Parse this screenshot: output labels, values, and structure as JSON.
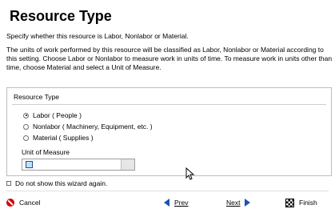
{
  "header": {
    "title": "Resource Type",
    "subtitle": "Specify whether this resource is Labor, Nonlabor or Material.",
    "description": "The units of work performed by this resource will be classified as Labor, Nonlabor or Material according to this setting. Choose Labor or Nonlabor to measure work in units of time.  To measure work in units other than time, choose Material and select a Unit of Measure."
  },
  "resource_type": {
    "group_label": "Resource Type",
    "options": [
      {
        "label": "Labor ( People )",
        "selected": true
      },
      {
        "label": "Nonlabor ( Machinery, Equipment, etc. )",
        "selected": false
      },
      {
        "label": "Material ( Supplies )",
        "selected": false
      }
    ],
    "unit_label": "Unit of Measure",
    "unit_value": ""
  },
  "wizard": {
    "do_not_show_label": "Do not show this wizard again.",
    "checked": false
  },
  "footer": {
    "cancel_label": "Cancel",
    "prev_label": "Prev",
    "next_label": "Next",
    "finish_label": "Finish"
  },
  "colors": {
    "accent_blue": "#1d53b5",
    "cancel_red": "#d40000"
  }
}
